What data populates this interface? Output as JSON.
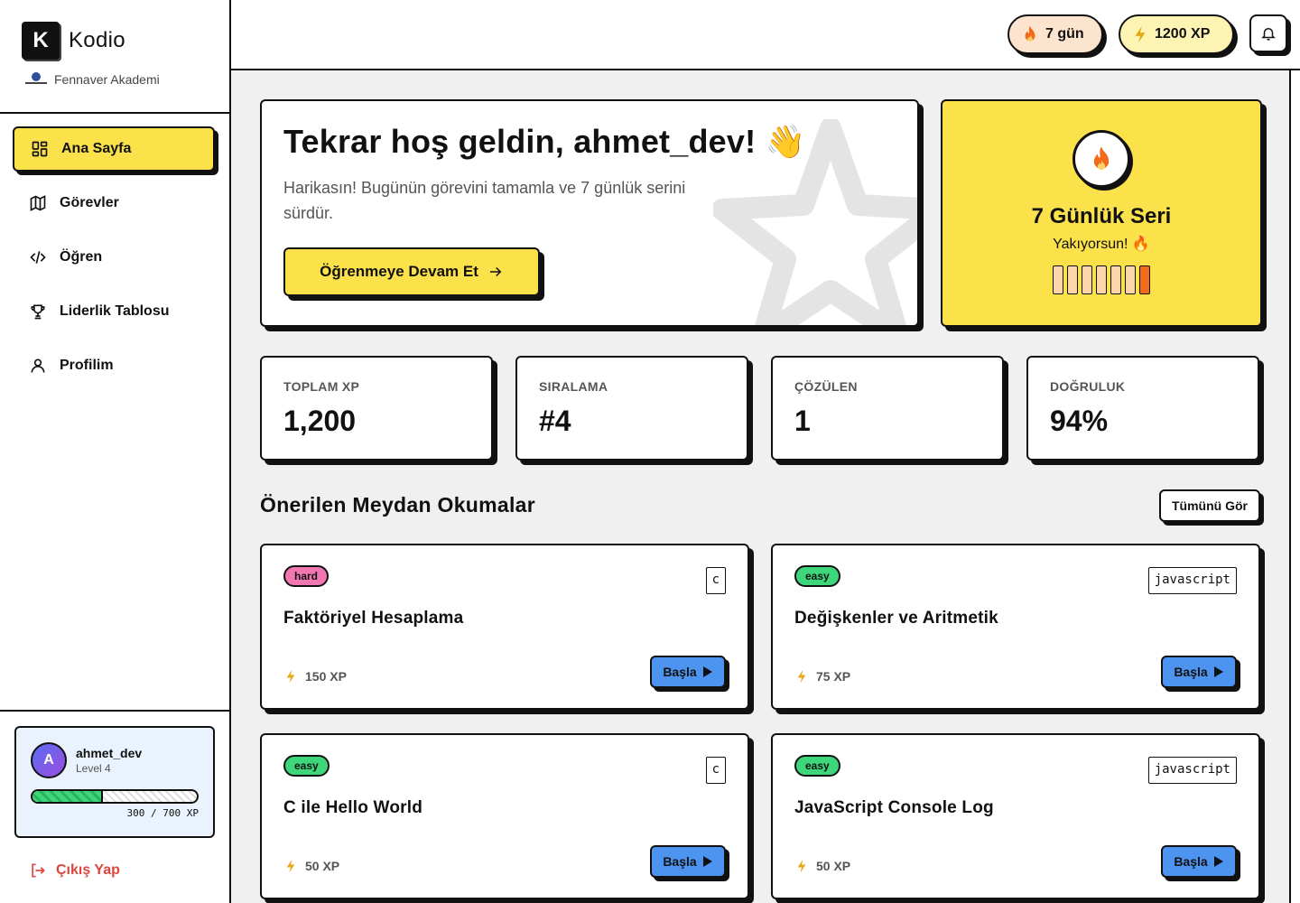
{
  "brand": {
    "logo_letter": "K",
    "name": "Kodio",
    "org": "Fennaver Akademi"
  },
  "nav": {
    "items": [
      {
        "label": "Ana Sayfa",
        "icon": "grid-icon",
        "active": true
      },
      {
        "label": "Görevler",
        "icon": "map-icon",
        "active": false
      },
      {
        "label": "Öğren",
        "icon": "code-icon",
        "active": false
      },
      {
        "label": "Liderlik Tablosu",
        "icon": "trophy-icon",
        "active": false
      },
      {
        "label": "Profilim",
        "icon": "user-icon",
        "active": false
      }
    ]
  },
  "user": {
    "avatar_letter": "A",
    "name": "ahmet_dev",
    "level": "Level 4",
    "xp_text": "300 / 700 XP",
    "xp_fraction": 0.43
  },
  "logout_label": "Çıkış Yap",
  "topbar": {
    "streak": "7 gün",
    "xp": "1200 XP"
  },
  "welcome": {
    "title": "Tekrar hoş geldin, ahmet_dev! 👋",
    "subtitle": "Harikasın! Bugünün görevini tamamla ve 7 günlük serini sürdür.",
    "cta": "Öğrenmeye Devam Et"
  },
  "streak_card": {
    "title": "7 Günlük Seri",
    "subtitle": "Yakıyorsun! 🔥",
    "days": 7
  },
  "stats": [
    {
      "label": "TOPLAM XP",
      "value": "1,200"
    },
    {
      "label": "SIRALAMA",
      "value": "#4"
    },
    {
      "label": "ÇÖZÜLEN",
      "value": "1"
    },
    {
      "label": "DOĞRULUK",
      "value": "94%"
    }
  ],
  "challenges_section": {
    "title": "Önerilen Meydan Okumalar",
    "see_all": "Tümünü Gör"
  },
  "challenges": [
    {
      "difficulty": "hard",
      "lang": "c",
      "title": "Faktöriyel Hesaplama",
      "reward": "150 XP",
      "action": "Başla"
    },
    {
      "difficulty": "easy",
      "lang": "javascript",
      "title": "Değişkenler ve Aritmetik",
      "reward": "75 XP",
      "action": "Başla"
    },
    {
      "difficulty": "easy",
      "lang": "c",
      "title": "C ile Hello World",
      "reward": "50 XP",
      "action": "Başla"
    },
    {
      "difficulty": "easy",
      "lang": "javascript",
      "title": "JavaScript Console Log",
      "reward": "50 XP",
      "action": "Başla"
    }
  ],
  "colors": {
    "accent_yellow": "#fbe14a",
    "start_blue": "#4d94f0",
    "hard_pink": "#f277b0",
    "easy_green": "#3ed67a",
    "logout_red": "#e0453c"
  }
}
